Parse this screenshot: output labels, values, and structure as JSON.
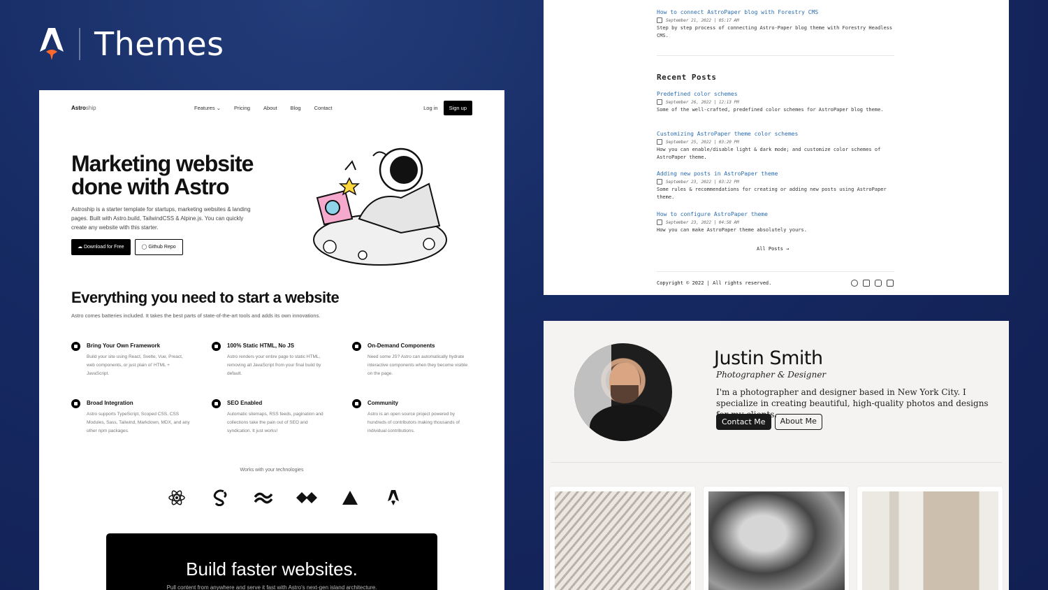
{
  "page": {
    "title": "Themes"
  },
  "astroship": {
    "logo_bold": "Astro",
    "logo_light": "ship",
    "nav": [
      "Features",
      "Pricing",
      "About",
      "Blog",
      "Contact"
    ],
    "features_chevron": "⌄",
    "login": "Log in",
    "signup": "Sign up",
    "hero_title": "Marketing website done with Astro",
    "hero_desc": "Astroship is a starter template for startups, marketing websites & landing pages. Built with Astro.build, TailwindCSS & Alpine.js. You can quickly create any website with this starter.",
    "download_btn": "Download for Free",
    "github_btn": "Github Repo",
    "section_title": "Everything you need to start a website",
    "section_desc": "Astro comes batteries included. It takes the best parts of state-of-the-art tools and adds its own innovations.",
    "features": [
      {
        "title": "Bring Your Own Framework",
        "desc": "Build your site using React, Svelte, Vue, Preact, web components, or just plain ol' HTML + JavaScript."
      },
      {
        "title": "100% Static HTML, No JS",
        "desc": "Astro renders your entire page to static HTML, removing all JavaScript from your final build by default."
      },
      {
        "title": "On-Demand Components",
        "desc": "Need some JS? Astro can automatically hydrate interactive components when they become visible on the page."
      },
      {
        "title": "Broad Integration",
        "desc": "Astro supports TypeScript, Scoped CSS, CSS Modules, Sass, Tailwind, Markdown, MDX, and any other npm packages."
      },
      {
        "title": "SEO Enabled",
        "desc": "Automatic sitemaps, RSS feeds, pagination and collections take the pain out of SEO and syndication. It just works!"
      },
      {
        "title": "Community",
        "desc": "Astro is an open source project powered by hundreds of contributors making thousands of individual contributions."
      }
    ],
    "tech_label": "Works with your technologies",
    "tech_icons": [
      "react-icon",
      "svelte-icon",
      "tailwind-icon",
      "alpine-icon",
      "vercel-icon",
      "astro-icon"
    ],
    "cta_title": "Build faster websites.",
    "cta_sub": "Pull content from anywhere and serve it fast with Astro's next-gen island architecture."
  },
  "astropaper": {
    "top_post": {
      "title": "How to connect AstroPaper blog with Forestry CMS",
      "date": "September 21, 2022 | 05:17 AM",
      "desc": "Step by step process of connecting Astro-Paper blog theme with Forestry Headless CMS."
    },
    "recent_heading": "Recent Posts",
    "posts": [
      {
        "title": "Predefined color schemes",
        "date": "September 26, 2022 | 12:13 PM",
        "desc": "Some of the well-crafted, predefined color schemes for AstroPaper blog theme."
      },
      {
        "title": "Customizing AstroPaper theme color schemes",
        "date": "September 25, 2022 | 03:20 PM",
        "desc": "How you can enable/disable light & dark mode; and customize color schemes of AstroPaper theme."
      },
      {
        "title": "Adding new posts in AstroPaper theme",
        "date": "September 23, 2022 | 03:22 PM",
        "desc": "Some rules & recommendations for creating or adding new posts using AstroPaper theme."
      },
      {
        "title": "How to configure AstroPaper theme",
        "date": "September 23, 2022 | 04:58 AM",
        "desc": "How you can make AstroPaper theme absolutely yours."
      }
    ],
    "all_posts": "All Posts →",
    "copyright": "Copyright © 2022 | All rights reserved.",
    "socials": [
      "github-icon",
      "facebook-icon",
      "instagram-icon",
      "linkedin-icon"
    ]
  },
  "portfolio": {
    "name": "Justin Smith",
    "role": "Photographer & Designer",
    "bio": "I'm a photographer and designer based in New York City. I specialize in creating beautiful, high-quality photos and designs for my clients.",
    "contact_btn": "Contact Me",
    "about_btn": "About Me"
  }
}
